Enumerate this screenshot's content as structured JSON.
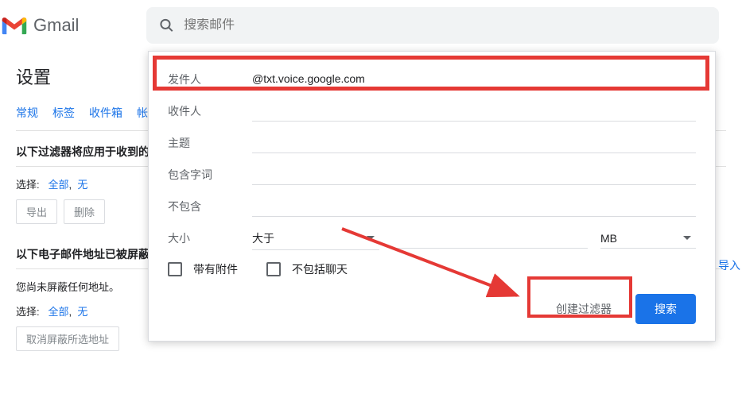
{
  "header": {
    "logo_text": "Gmail",
    "search_placeholder": "搜索邮件"
  },
  "settings": {
    "title": "设置",
    "tabs": [
      "常规",
      "标签",
      "收件箱",
      "帐"
    ],
    "section1": {
      "title": "以下过滤器将应用于收到的",
      "select_label": "选择:",
      "select_all": "全部",
      "select_none": "无",
      "export_btn": "导出",
      "delete_btn": "删除"
    },
    "section2": {
      "title": "以下电子邮件地址已被屏蔽",
      "empty_text": "您尚未屏蔽任何地址。",
      "select_label": "选择:",
      "select_all": "全部",
      "select_none": "无",
      "unblock_btn": "取消屏蔽所选地址"
    },
    "import_link": "导入"
  },
  "dialog": {
    "from_label": "发件人",
    "from_value": "@txt.voice.google.com",
    "to_label": "收件人",
    "subject_label": "主题",
    "includes_label": "包含字词",
    "excludes_label": "不包含",
    "size_label": "大小",
    "size_op": "大于",
    "size_unit": "MB",
    "checkbox1": "带有附件",
    "checkbox2": "不包括聊天",
    "create_filter": "创建过滤器",
    "search": "搜索"
  }
}
